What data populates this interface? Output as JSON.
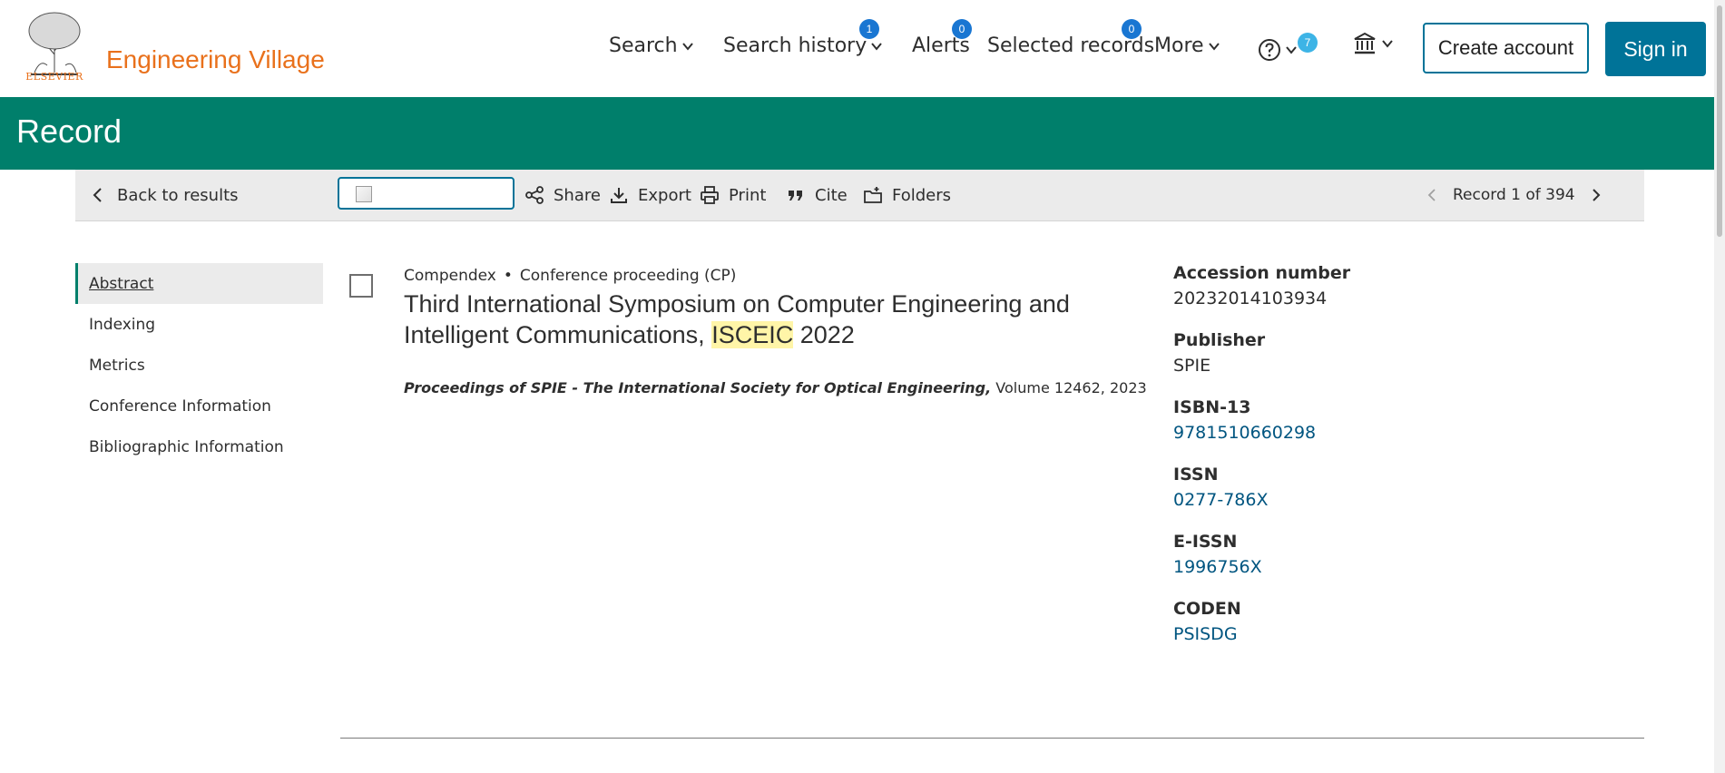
{
  "header": {
    "brand": "Engineering Village",
    "publisher_logo_text": "ELSEVIER",
    "nav": {
      "search": "Search",
      "search_history": "Search history",
      "search_history_count": "1",
      "alerts": "Alerts",
      "alerts_count": "0",
      "selected_records": "Selected records",
      "selected_records_count": "0",
      "more": "More",
      "help_count": "7"
    },
    "create_account": "Create account",
    "sign_in": "Sign in"
  },
  "banner": {
    "title": "Record"
  },
  "toolbar": {
    "back": "Back to results",
    "share": "Share",
    "export": "Export",
    "print": "Print",
    "cite": "Cite",
    "folders": "Folders",
    "record_position": "Record 1 of 394"
  },
  "sidenav": {
    "items": [
      "Abstract",
      "Indexing",
      "Metrics",
      "Conference Information",
      "Bibliographic Information"
    ]
  },
  "record": {
    "database": "Compendex",
    "doc_type": "Conference proceeding (CP)",
    "title_before": "Third International Symposium on Computer Engineering and Intelligent Communications,",
    "title_highlight": "ISCEIC",
    "title_after": "2022",
    "source_journal": "Proceedings of SPIE - The International Society for Optical Engineering,",
    "source_detail": "Volume 12462, 2023"
  },
  "details": {
    "accession_label": "Accession number",
    "accession_value": "20232014103934",
    "publisher_label": "Publisher",
    "publisher_value": "SPIE",
    "isbn_label": "ISBN-13",
    "isbn_value": "9781510660298",
    "issn_label": "ISSN",
    "issn_value": "0277-786X",
    "eissn_label": "E-ISSN",
    "eissn_value": "1996756X",
    "coden_label": "CODEN",
    "coden_value": "PSISDG"
  },
  "colors": {
    "brand_orange": "#e9711c",
    "banner_green": "#007f6b",
    "primary_blue": "#007398",
    "badge_blue": "#1976d2",
    "highlight": "#fff5a8"
  }
}
